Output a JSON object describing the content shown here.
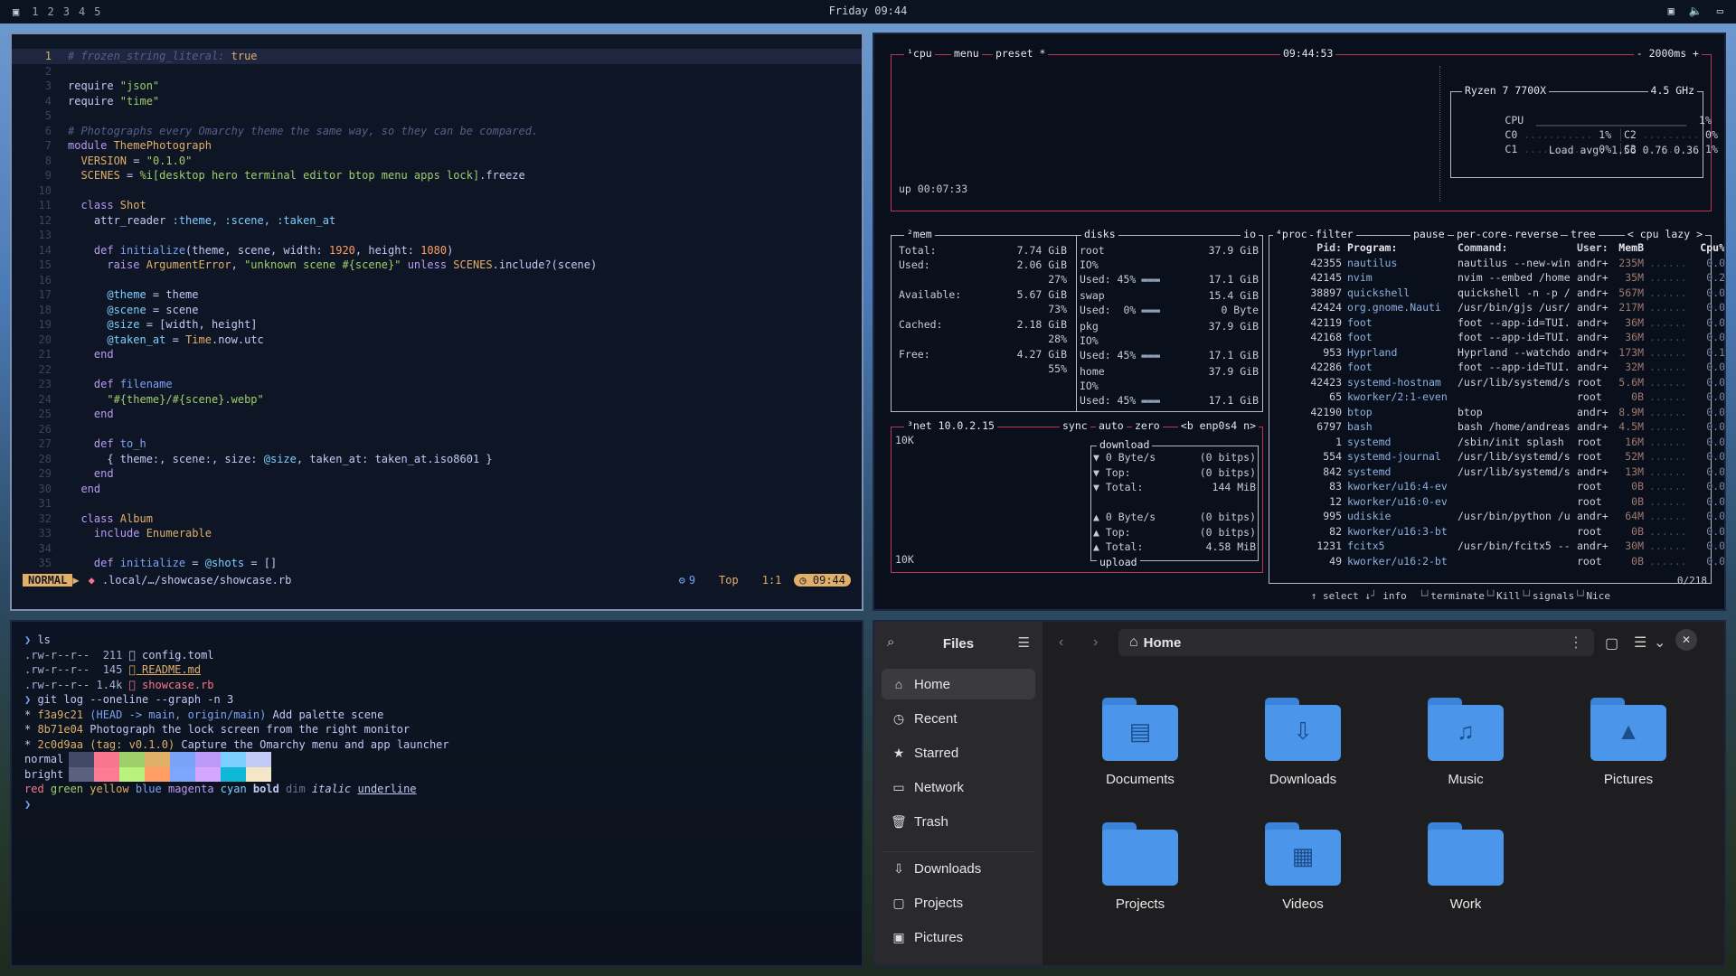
{
  "topbar": {
    "workspaces": [
      "1",
      "2",
      "3",
      "4",
      "5"
    ],
    "clock": "Friday 09:44"
  },
  "editor": {
    "lines": [
      {
        "n": "1",
        "t": [
          [
            "c",
            "# frozen_string_literal: "
          ],
          [
            "t",
            "true"
          ]
        ],
        "cur": true
      },
      {
        "n": "2",
        "t": []
      },
      {
        "n": "3",
        "t": [
          [
            "p",
            "require "
          ],
          [
            "s",
            "\"json\""
          ]
        ]
      },
      {
        "n": "4",
        "t": [
          [
            "p",
            "require "
          ],
          [
            "s",
            "\"time\""
          ]
        ]
      },
      {
        "n": "5",
        "t": []
      },
      {
        "n": "6",
        "t": [
          [
            "c",
            "# Photographs every Omarchy theme the same way, so they can be compared."
          ]
        ]
      },
      {
        "n": "7",
        "t": [
          [
            "k",
            "module "
          ],
          [
            "t",
            "ThemePhotograph"
          ]
        ]
      },
      {
        "n": "8",
        "t": [
          [
            "t",
            "  VERSION"
          ],
          [
            "p",
            " = "
          ],
          [
            "s",
            "\"0.1.0\""
          ]
        ]
      },
      {
        "n": "9",
        "t": [
          [
            "t",
            "  SCENES"
          ],
          [
            "p",
            " = "
          ],
          [
            "s",
            "%i[desktop hero terminal editor btop menu apps lock]"
          ],
          [
            "p",
            ".freeze"
          ]
        ]
      },
      {
        "n": "10",
        "t": []
      },
      {
        "n": "11",
        "t": [
          [
            "k",
            "  class "
          ],
          [
            "t",
            "Shot"
          ]
        ]
      },
      {
        "n": "12",
        "t": [
          [
            "p",
            "    attr_reader "
          ],
          [
            "v",
            ":theme, :scene, :taken_at"
          ]
        ]
      },
      {
        "n": "13",
        "t": []
      },
      {
        "n": "14",
        "t": [
          [
            "k",
            "    def "
          ],
          [
            "f",
            "initialize"
          ],
          [
            "p",
            "(theme, scene, width: "
          ],
          [
            "n",
            "1920"
          ],
          [
            "p",
            ", height: "
          ],
          [
            "n",
            "1080"
          ],
          [
            "p",
            ")"
          ]
        ]
      },
      {
        "n": "15",
        "t": [
          [
            "k",
            "      raise "
          ],
          [
            "t",
            "ArgumentError"
          ],
          [
            "p",
            ", "
          ],
          [
            "s",
            "\"unknown scene #{scene}\""
          ],
          [
            "k",
            " unless "
          ],
          [
            "t",
            "SCENES"
          ],
          [
            "p",
            ".include?(scene)"
          ]
        ]
      },
      {
        "n": "16",
        "t": []
      },
      {
        "n": "17",
        "t": [
          [
            "v",
            "      @theme"
          ],
          [
            "p",
            " = theme"
          ]
        ]
      },
      {
        "n": "18",
        "t": [
          [
            "v",
            "      @scene"
          ],
          [
            "p",
            " = scene"
          ]
        ]
      },
      {
        "n": "19",
        "t": [
          [
            "v",
            "      @size"
          ],
          [
            "p",
            " = [width, height]"
          ]
        ]
      },
      {
        "n": "20",
        "t": [
          [
            "v",
            "      @taken_at"
          ],
          [
            "p",
            " = "
          ],
          [
            "t",
            "Time"
          ],
          [
            "p",
            ".now.utc"
          ]
        ]
      },
      {
        "n": "21",
        "t": [
          [
            "k",
            "    end"
          ]
        ]
      },
      {
        "n": "22",
        "t": []
      },
      {
        "n": "23",
        "t": [
          [
            "k",
            "    def "
          ],
          [
            "f",
            "filename"
          ]
        ]
      },
      {
        "n": "24",
        "t": [
          [
            "s",
            "      \"#{theme}/#{scene}.webp\""
          ]
        ]
      },
      {
        "n": "25",
        "t": [
          [
            "k",
            "    end"
          ]
        ]
      },
      {
        "n": "26",
        "t": []
      },
      {
        "n": "27",
        "t": [
          [
            "k",
            "    def "
          ],
          [
            "f",
            "to_h"
          ]
        ]
      },
      {
        "n": "28",
        "t": [
          [
            "p",
            "      { theme:, scene:, size: "
          ],
          [
            "v",
            "@size"
          ],
          [
            "p",
            ", taken_at: taken_at.iso8601 }"
          ]
        ]
      },
      {
        "n": "29",
        "t": [
          [
            "k",
            "    end"
          ]
        ]
      },
      {
        "n": "30",
        "t": [
          [
            "k",
            "  end"
          ]
        ]
      },
      {
        "n": "31",
        "t": []
      },
      {
        "n": "32",
        "t": [
          [
            "k",
            "  class "
          ],
          [
            "t",
            "Album"
          ]
        ]
      },
      {
        "n": "33",
        "t": [
          [
            "k",
            "    include "
          ],
          [
            "t",
            "Enumerable"
          ]
        ]
      },
      {
        "n": "34",
        "t": []
      },
      {
        "n": "35",
        "t": [
          [
            "k",
            "    def "
          ],
          [
            "f",
            "initialize"
          ],
          [
            "p",
            " = "
          ],
          [
            "v",
            "@shots"
          ],
          [
            "p",
            " = []"
          ]
        ]
      }
    ],
    "status": {
      "mode": "NORMAL",
      "path": ".local/…/showcase/showcase.rb",
      "lsp": "9",
      "pos": "Top",
      "cursor": "1:1",
      "time": "09:44"
    }
  },
  "btop": {
    "cpu_header": {
      "tab": "¹cpu",
      "menu": "menu",
      "preset": "preset *",
      "clock": "09:44:53",
      "interval": "- 2000ms +"
    },
    "uptime": "up 00:07:33",
    "cpu_model": "Ryzen 7 7700X",
    "cpu_freq": "4.5 GHz",
    "cpu_rows": [
      {
        "label": "CPU",
        "val": "1%"
      },
      {
        "label": "C0",
        "val": "1%",
        "label2": "C2",
        "val2": "0%"
      },
      {
        "label": "C1",
        "val": "0%",
        "label2": "C3",
        "val2": "1%"
      }
    ],
    "load_avg": "Load avg: 1.56 0.76 0.36",
    "mem": {
      "title": "²mem",
      "total_label": "Total:",
      "total": "7.74 GiB",
      "used_label": "Used:",
      "used": "2.06 GiB",
      "used_pct": "27%",
      "avail_label": "Available:",
      "avail": "5.67 GiB",
      "avail_pct": "73%",
      "cached_label": "Cached:",
      "cached": "2.18 GiB",
      "cached_pct": "28%",
      "free_label": "Free:",
      "free": "4.27 GiB",
      "free_pct": "55%"
    },
    "disks": {
      "title": "disks",
      "io": "io",
      "items": [
        {
          "name": "root",
          "size": "37.9 GiB",
          "io": "IO%",
          "used": "Used: 45%",
          "usedv": "17.1 GiB"
        },
        {
          "name": "swap",
          "size": "15.4 GiB",
          "io": "",
          "used": "Used:  0%",
          "usedv": "0 Byte"
        },
        {
          "name": "pkg",
          "size": "37.9 GiB",
          "io": "IO%",
          "used": "Used: 45%",
          "usedv": "17.1 GiB"
        },
        {
          "name": "home",
          "size": "37.9 GiB",
          "io": "IO%",
          "used": "Used: 45%",
          "usedv": "17.1 GiB"
        }
      ]
    },
    "net": {
      "title": "³net",
      "ip": "10.0.2.15",
      "sync": "sync",
      "auto": "auto",
      "zero": "zero",
      "iface": "<b enp0s4 n>",
      "scale_top": "10K",
      "scale_bottom": "10K",
      "download": "download",
      "upload": "upload",
      "down_rows": [
        [
          "▼ 0 Byte/s",
          "(0 bitps)"
        ],
        [
          "▼ Top:",
          "(0 bitps)"
        ],
        [
          "▼ Total:",
          "144 MiB"
        ]
      ],
      "up_rows": [
        [
          "▲ 0 Byte/s",
          "(0 bitps)"
        ],
        [
          "▲ Top:",
          "(0 bitps)"
        ],
        [
          "▲ Total:",
          "4.58 MiB"
        ]
      ]
    },
    "proc": {
      "title": "⁴proc",
      "filter": "filter",
      "pause": "pause",
      "percore": "per-core",
      "reverse": "reverse",
      "tree": "tree",
      "sort": "< cpu lazy >",
      "headers": {
        "pid": "Pid:",
        "prog": "Program:",
        "cmd": "Command:",
        "user": "User:",
        "mem": "MemB",
        "cpu": "Cpu%"
      },
      "rows": [
        [
          "42355",
          "nautilus",
          "nautilus --new-win",
          "andr+",
          "235M",
          "0.0"
        ],
        [
          "42145",
          "nvim",
          "nvim --embed /home",
          "andr+",
          "35M",
          "0.2"
        ],
        [
          "38897",
          "quickshell",
          "quickshell -n -p /",
          "andr+",
          "567M",
          "0.0"
        ],
        [
          "42424",
          "org.gnome.Nauti",
          "/usr/bin/gjs /usr/",
          "andr+",
          "217M",
          "0.0"
        ],
        [
          "42119",
          "foot",
          "foot --app-id=TUI.",
          "andr+",
          "36M",
          "0.0"
        ],
        [
          "42168",
          "foot",
          "foot --app-id=TUI.",
          "andr+",
          "36M",
          "0.0"
        ],
        [
          "953",
          "Hyprland",
          "Hyprland --watchdo",
          "andr+",
          "173M",
          "0.1"
        ],
        [
          "42286",
          "foot",
          "foot --app-id=TUI.",
          "andr+",
          "32M",
          "0.0"
        ],
        [
          "42423",
          "systemd-hostnam",
          "/usr/lib/systemd/s",
          "root",
          "5.6M",
          "0.0"
        ],
        [
          "65",
          "kworker/2:1-even",
          "",
          "root",
          "0B",
          "0.0"
        ],
        [
          "42190",
          "btop",
          "btop",
          "andr+",
          "8.9M",
          "0.0"
        ],
        [
          "6797",
          "bash",
          "bash /home/andreas",
          "andr+",
          "4.5M",
          "0.0"
        ],
        [
          "1",
          "systemd",
          "/sbin/init splash",
          "root",
          "16M",
          "0.0"
        ],
        [
          "554",
          "systemd-journal",
          "/usr/lib/systemd/s",
          "root",
          "52M",
          "0.0"
        ],
        [
          "842",
          "systemd",
          "/usr/lib/systemd/s",
          "andr+",
          "13M",
          "0.0"
        ],
        [
          "83",
          "kworker/u16:4-ev",
          "",
          "root",
          "0B",
          "0.0"
        ],
        [
          "12",
          "kworker/u16:0-ev",
          "",
          "root",
          "0B",
          "0.0"
        ],
        [
          "995",
          "udiskie",
          "/usr/bin/python /u",
          "andr+",
          "64M",
          "0.0"
        ],
        [
          "82",
          "kworker/u16:3-bt",
          "",
          "root",
          "0B",
          "0.0"
        ],
        [
          "1231",
          "fcitx5",
          "/usr/bin/fcitx5 --",
          "andr+",
          "30M",
          "0.0"
        ],
        [
          "49",
          "kworker/u16:2-bt",
          "",
          "root",
          "0B",
          "0.0"
        ]
      ],
      "footer": {
        "select": "↑ select ↓",
        "info": "info",
        "terminate": "terminate",
        "kill": "Kill",
        "signals": "signals",
        "nice": "Nice",
        "count": "0/218"
      }
    }
  },
  "terminal": {
    "lines": [
      [
        [
          "p",
          "❯ "
        ],
        [
          "w",
          "ls"
        ]
      ],
      [
        [
          "d",
          ".rw-r--r--  211 "
        ],
        [
          "w",
          "󰈙 config.toml"
        ]
      ],
      [
        [
          "d",
          ".rw-r--r--  145 "
        ],
        [
          "y",
          "󰂺 README.md"
        ]
      ],
      [
        [
          "d",
          ".rw-r--r-- 1.4k "
        ],
        [
          "r",
          "󰴭 showcase.rb"
        ]
      ],
      [
        [
          "p",
          "❯ "
        ],
        [
          "w",
          "git log --oneline --graph -n 3"
        ]
      ],
      [
        [
          "w",
          "* "
        ],
        [
          "y",
          "f3a9c21 "
        ],
        [
          "b",
          "(HEAD -> main, origin/main) "
        ],
        [
          "w",
          "Add palette scene"
        ]
      ],
      [
        [
          "w",
          "* "
        ],
        [
          "y",
          "8b71e04 "
        ],
        [
          "w",
          "Photograph the lock screen from the right monitor"
        ]
      ],
      [
        [
          "w",
          "* "
        ],
        [
          "y",
          "2c0d9aa "
        ],
        [
          "y",
          "(tag: v0.1.0) "
        ],
        [
          "w",
          "Capture the Omarchy menu and app launcher"
        ]
      ],
      [
        [
          "w",
          "normal"
        ]
      ],
      [
        [
          "w",
          "bright"
        ]
      ],
      [
        [
          "r",
          "red "
        ],
        [
          "g",
          "green "
        ],
        [
          "y",
          "yellow "
        ],
        [
          "b",
          "blue "
        ],
        [
          "m",
          "magenta "
        ],
        [
          "c",
          "cyan "
        ],
        [
          "w",
          "bold "
        ],
        [
          "d",
          "dim "
        ],
        [
          "w",
          "italic "
        ],
        [
          "w",
          "underline"
        ]
      ],
      [
        [
          "p",
          "❯"
        ]
      ]
    ],
    "palette_normal": [
      "#414868",
      "#f7768e",
      "#9ece6a",
      "#e0af68",
      "#7aa2f7",
      "#bb9af7",
      "#7dcfff",
      "#c0caf5"
    ],
    "palette_bright": [
      "#5a607e",
      "#ff7a93",
      "#b9f27c",
      "#ff9e64",
      "#7da6ff",
      "#d4a6ff",
      "#0db9d7",
      "#f5e6c8"
    ]
  },
  "files": {
    "title": "Files",
    "location": "Home",
    "sidebar": [
      {
        "icon": "⌂",
        "label": "Home",
        "sel": true,
        "name": "home-icon"
      },
      {
        "icon": "◷",
        "label": "Recent",
        "name": "clock-icon"
      },
      {
        "icon": "★",
        "label": "Starred",
        "name": "star-icon"
      },
      {
        "icon": "▭",
        "label": "Network",
        "name": "network-icon"
      },
      {
        "icon": "🗑",
        "label": "Trash",
        "name": "trash-icon"
      },
      {
        "icon": "⇩",
        "label": "Downloads",
        "name": "download-icon"
      },
      {
        "icon": "▢",
        "label": "Projects",
        "name": "folder-icon"
      },
      {
        "icon": "▣",
        "label": "Pictures",
        "name": "image-icon"
      }
    ],
    "folders": [
      {
        "label": "Documents",
        "glyph": "▤",
        "name": "documents-folder-icon"
      },
      {
        "label": "Downloads",
        "glyph": "⇩",
        "name": "downloads-folder-icon"
      },
      {
        "label": "Music",
        "glyph": "♫",
        "name": "music-folder-icon"
      },
      {
        "label": "Pictures",
        "glyph": "▲",
        "name": "pictures-folder-icon"
      },
      {
        "label": "Projects",
        "glyph": "",
        "name": "projects-folder-icon"
      },
      {
        "label": "Videos",
        "glyph": "▦",
        "name": "videos-folder-icon"
      },
      {
        "label": "Work",
        "glyph": "",
        "name": "work-folder-icon"
      }
    ]
  }
}
